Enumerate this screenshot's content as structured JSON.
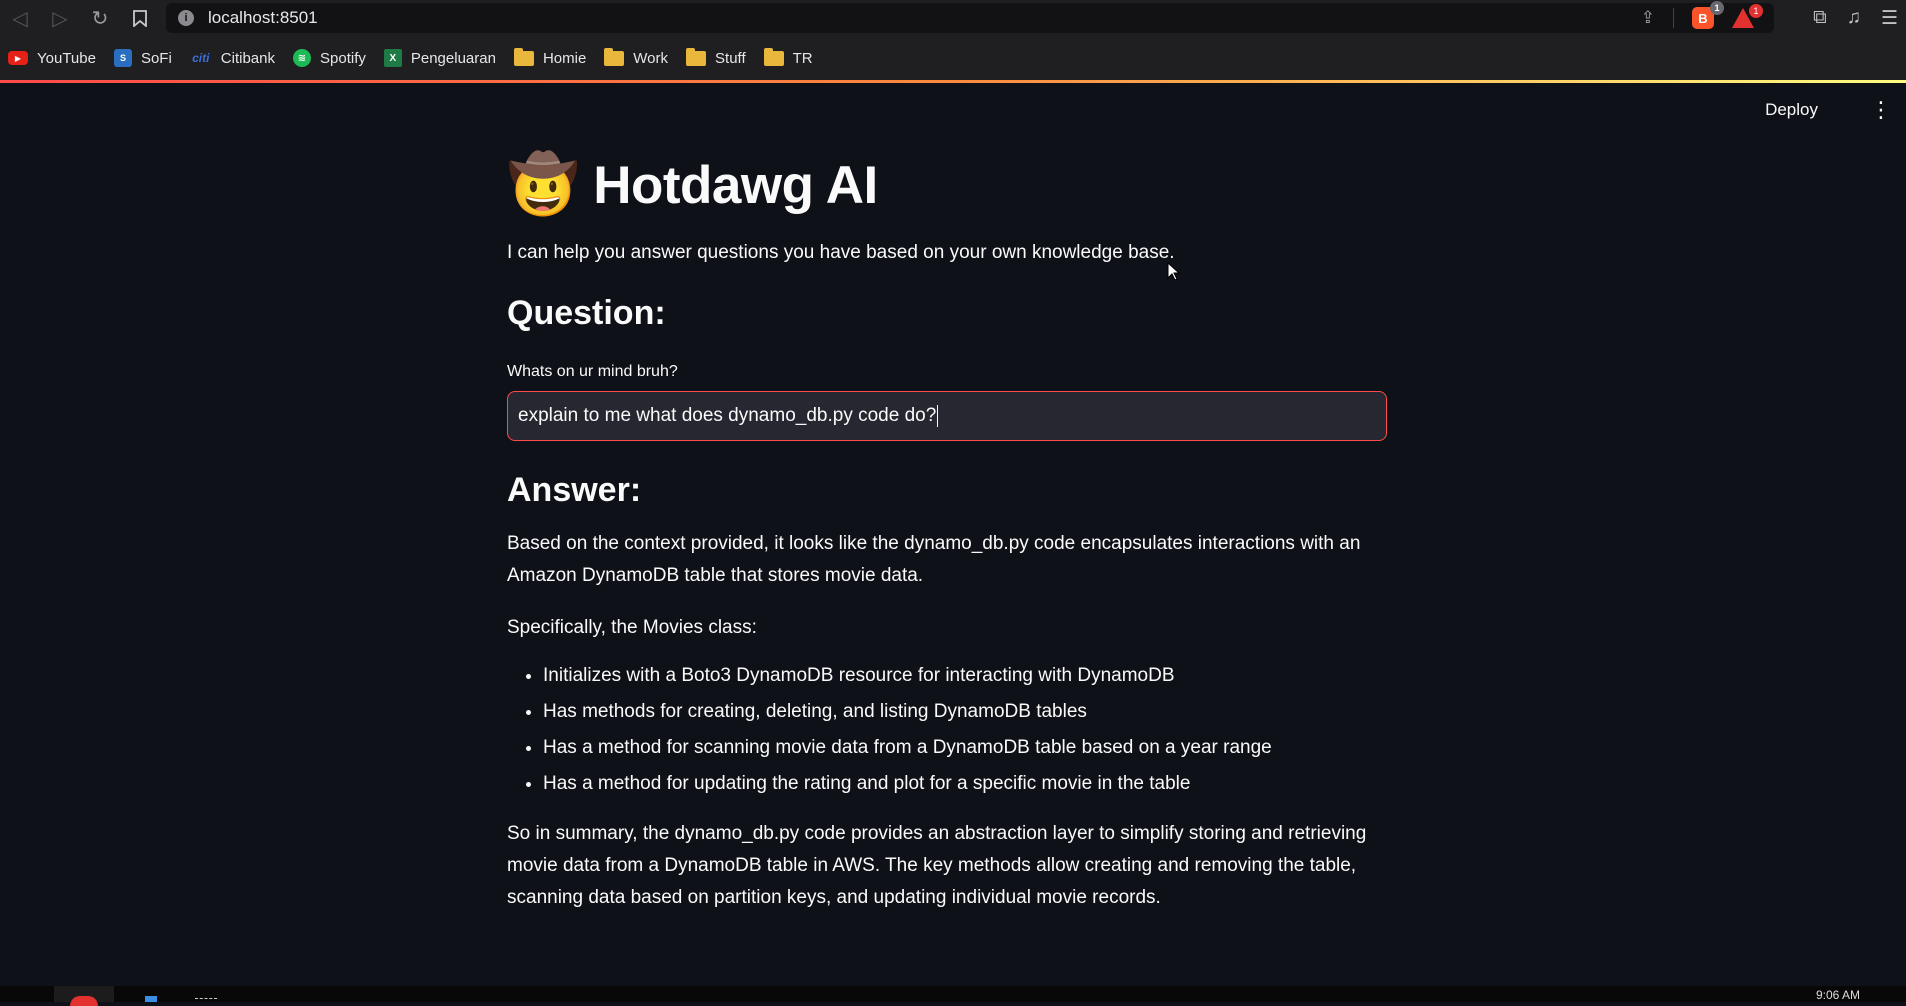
{
  "browser": {
    "url": "localhost:8501",
    "shields_badge": "1",
    "rewards_badge": "1"
  },
  "bookmarks": [
    {
      "label": "YouTube",
      "icon": "youtube-icon"
    },
    {
      "label": "SoFi",
      "icon": "sofi-icon"
    },
    {
      "label": "Citibank",
      "icon": "citibank-icon"
    },
    {
      "label": "Spotify",
      "icon": "spotify-icon"
    },
    {
      "label": "Pengeluaran",
      "icon": "excel-icon"
    },
    {
      "label": "Homie",
      "icon": "folder-icon"
    },
    {
      "label": "Work",
      "icon": "folder-icon"
    },
    {
      "label": "Stuff",
      "icon": "folder-icon"
    },
    {
      "label": "TR",
      "icon": "folder-icon"
    }
  ],
  "app": {
    "deploy_label": "Deploy",
    "title": "Hotdawg AI",
    "title_emoji": "🤠",
    "subtitle": "I can help you answer questions you have based on your own knowledge base.",
    "question_heading": "Question:",
    "input_label": "Whats on ur mind bruh?",
    "input_value": "explain to me what does dynamo_db.py code do?",
    "answer_heading": "Answer:",
    "answer_intro": "Based on the context provided, it looks like the dynamo_db.py code encapsulates interactions with an Amazon DynamoDB table that stores movie data.",
    "answer_specific": "Specifically, the Movies class:",
    "answer_points": [
      "Initializes with a Boto3 DynamoDB resource for interacting with DynamoDB",
      "Has methods for creating, deleting, and listing DynamoDB tables",
      "Has a method for scanning movie data from a DynamoDB table based on a year range",
      "Has a method for updating the rating and plot for a specific movie in the table"
    ],
    "answer_summary": "So in summary, the dynamo_db.py code provides an abstraction layer to simplify storing and retrieving movie data from a DynamoDB table in AWS. The key methods allow creating and removing the table, scanning data based on partition keys, and updating individual movie records."
  },
  "taskbar": {
    "time": "9:06 AM"
  },
  "colors": {
    "background": "#0e1117",
    "accent": "#ff4b4b",
    "input_bg": "#262730"
  }
}
